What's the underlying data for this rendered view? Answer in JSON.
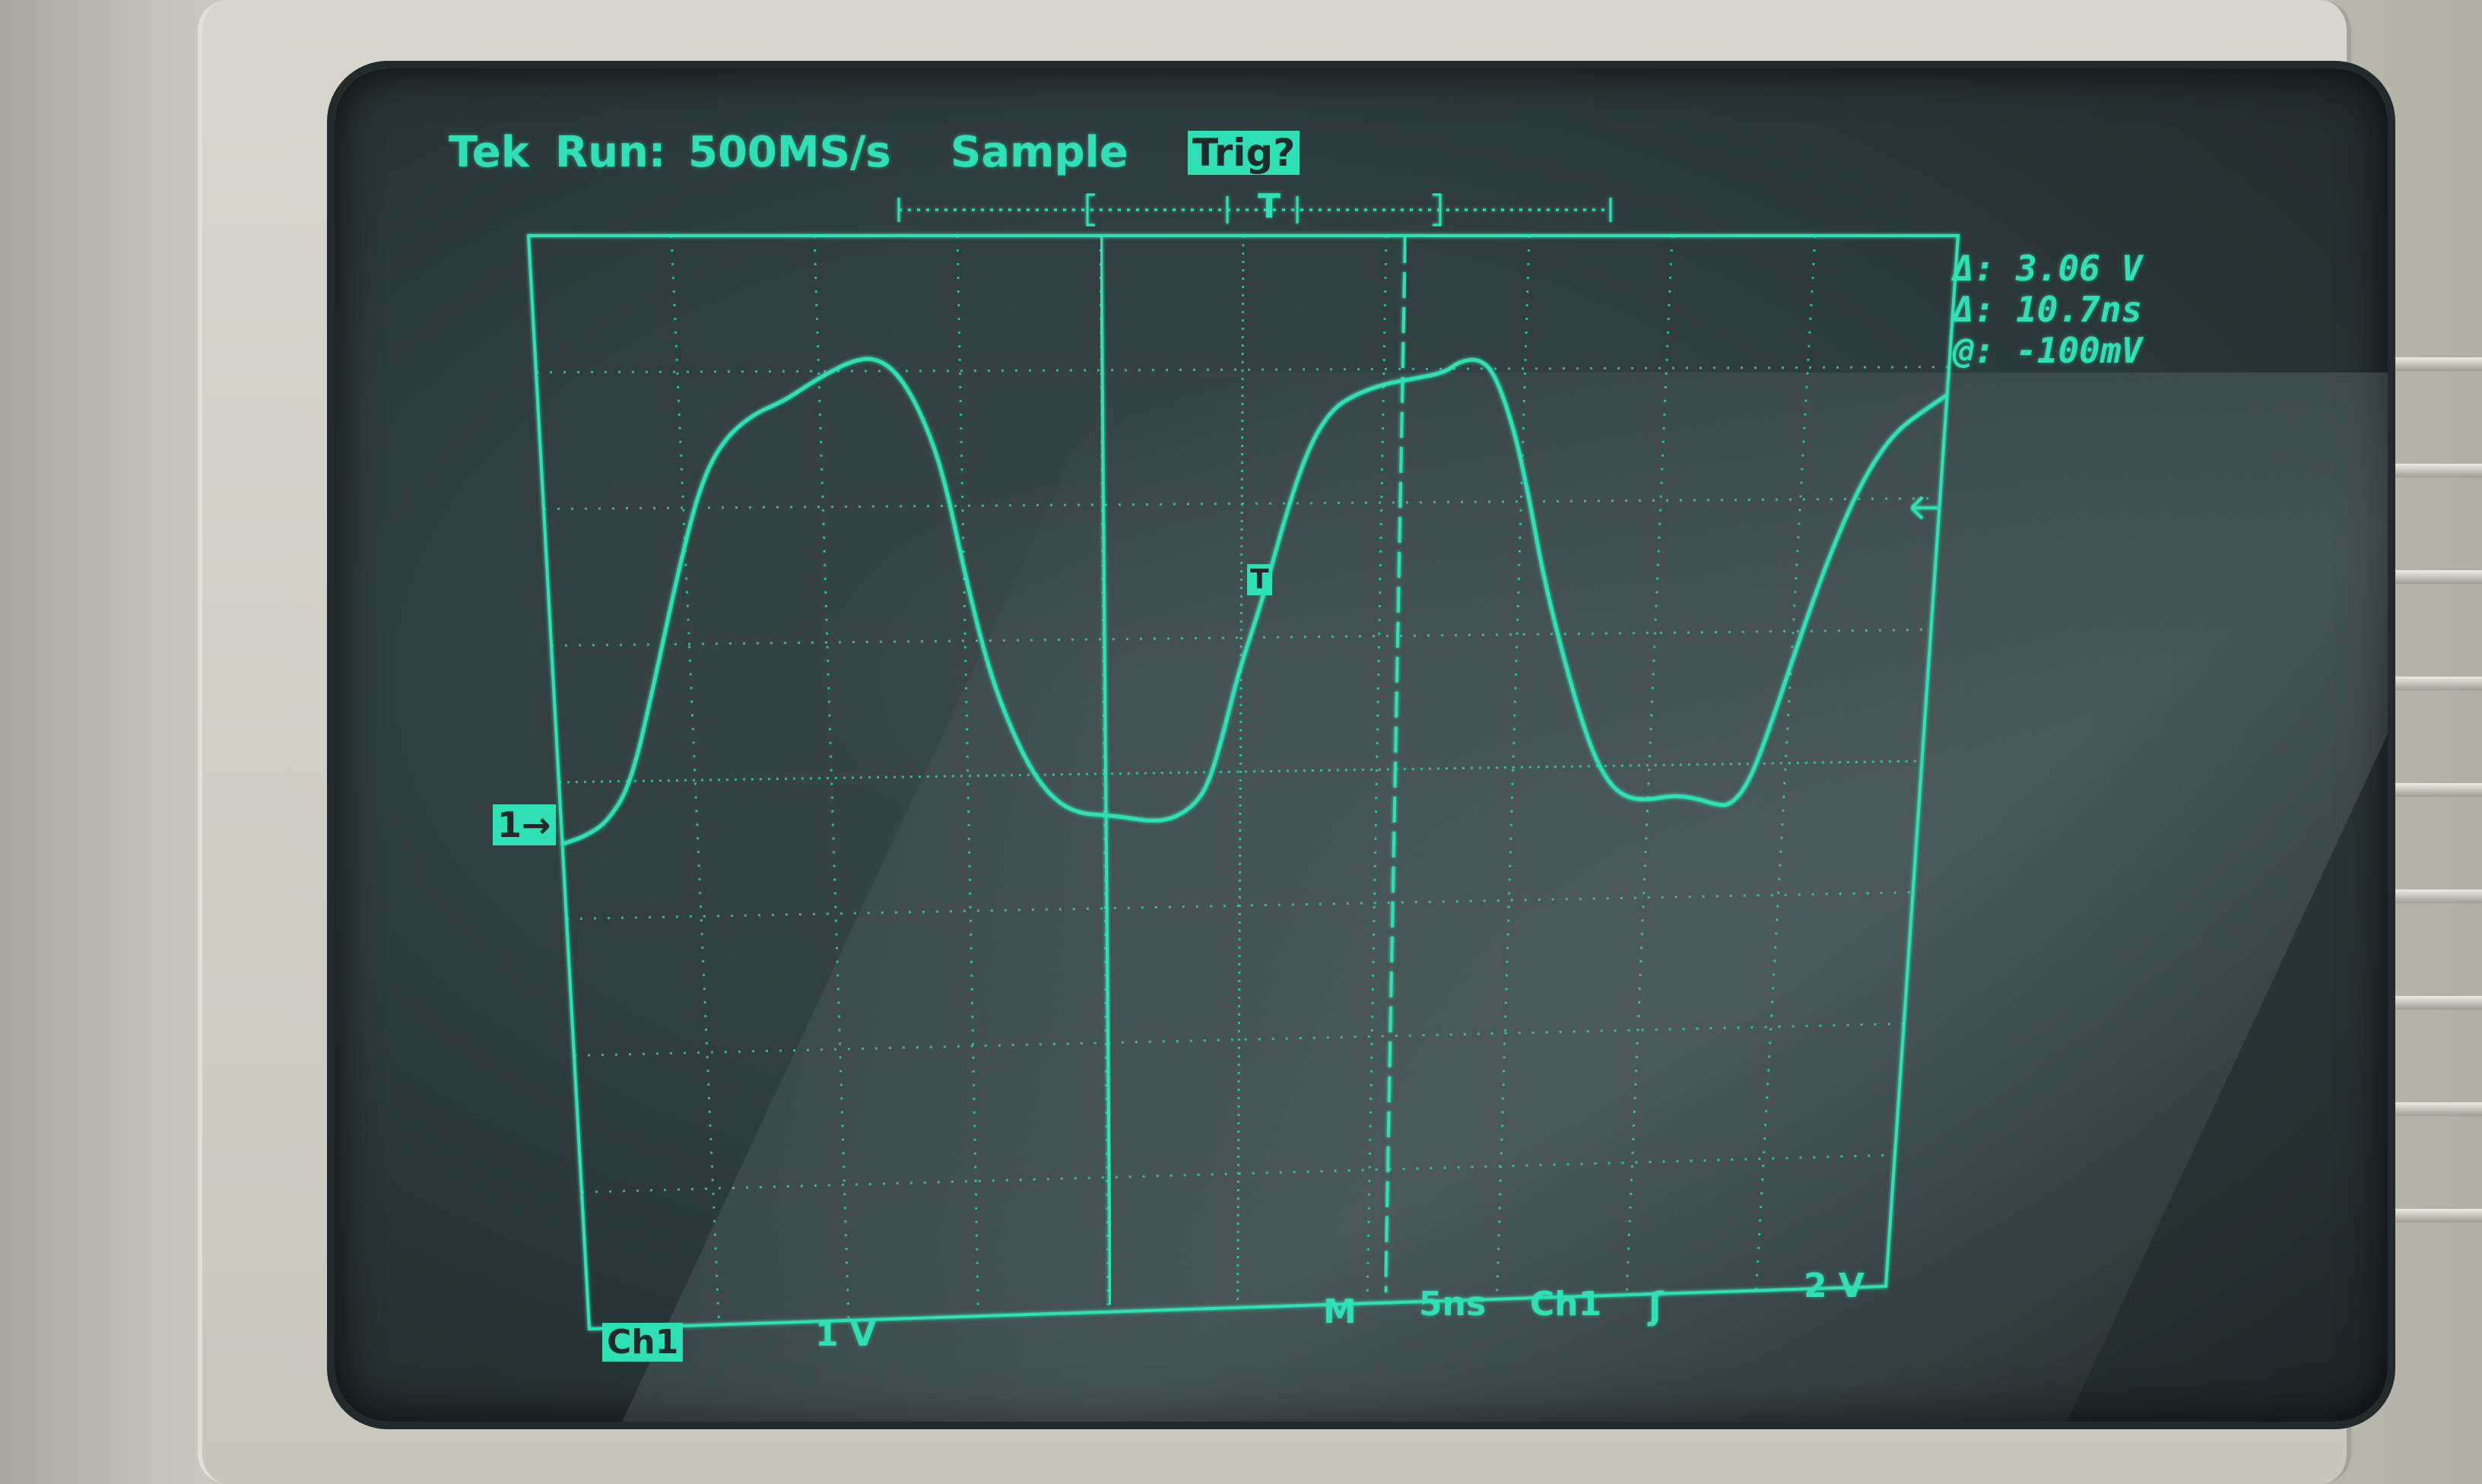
{
  "header": {
    "brand": "Tek",
    "run_state": "Run:",
    "sample_rate": "500MS/s",
    "mode": "Sample",
    "trigger_status": "Trig?"
  },
  "record_bar": {
    "trigger_marker": "T"
  },
  "cursor_readout": {
    "delta_v": "Δ: 3.06 V",
    "delta_t": "Δ: 10.7ns",
    "at_v": "@: -100mV"
  },
  "channel_marker": {
    "label": "1→"
  },
  "trigger_position_marker": {
    "label": "T"
  },
  "footer": {
    "ch1_label": "Ch1",
    "ch1_scale": "1 V",
    "timebase_mode": "M",
    "timebase": "5ns",
    "trigger_source": "Ch1",
    "trigger_slope": "ʃ",
    "trigger_level": "2 V"
  },
  "colors": {
    "trace": "#2fe0b4",
    "screen": "#2d3a3b"
  }
}
